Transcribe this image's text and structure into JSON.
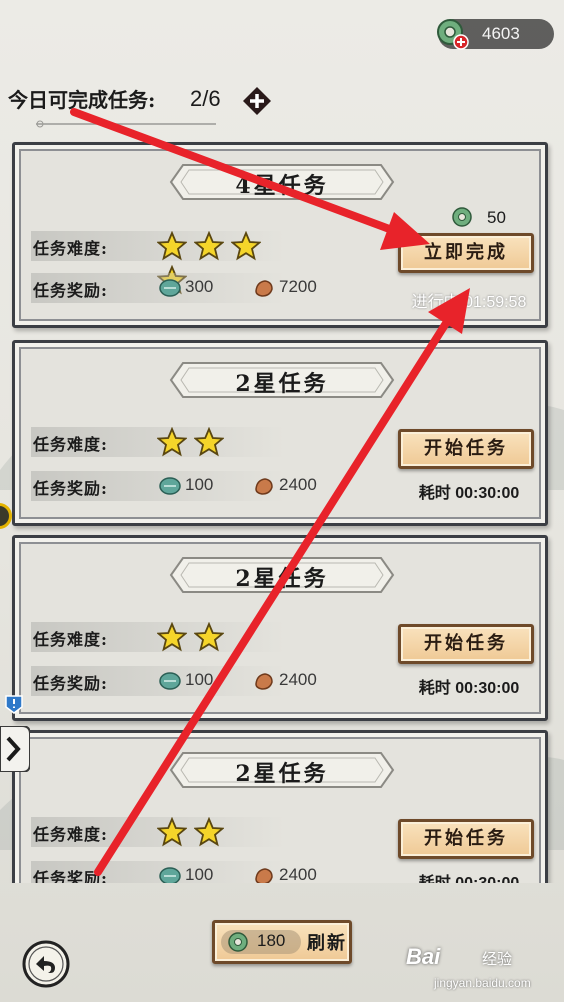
{
  "header": {
    "currency_amount": "4603",
    "daily_label": "今日可完成任务:",
    "daily_value": "2/6"
  },
  "tasks": [
    {
      "title": "4星任务",
      "difficulty_label": "任务难度:",
      "stars": 4,
      "reward_label": "任务奖励:",
      "reward_jade": "300",
      "reward_copper": "7200",
      "cost": "50",
      "button_label": "立即完成",
      "timer": "进行中 01:59:58"
    },
    {
      "title": "2星任务",
      "difficulty_label": "任务难度:",
      "stars": 2,
      "reward_label": "任务奖励:",
      "reward_jade": "100",
      "reward_copper": "2400",
      "button_label": "开始任务",
      "timer": "耗时 00:30:00"
    },
    {
      "title": "2星任务",
      "difficulty_label": "任务难度:",
      "stars": 2,
      "reward_label": "任务奖励:",
      "reward_jade": "100",
      "reward_copper": "2400",
      "button_label": "开始任务",
      "timer": "耗时 00:30:00"
    },
    {
      "title": "2星任务",
      "difficulty_label": "任务难度:",
      "stars": 2,
      "reward_label": "任务奖励:",
      "reward_jade": "100",
      "reward_copper": "2400",
      "button_label": "开始任务",
      "timer": "耗时 00:30:00"
    }
  ],
  "refresh": {
    "cost": "180",
    "label": "刷新"
  },
  "watermark": {
    "brand": "Bai",
    "brand2": "经验",
    "url": "jingyan.baidu.com"
  },
  "colors": {
    "arrow": "#e8232a",
    "button_fill": "#f6dcb2",
    "card_border": "#3b3e44",
    "star": "#f5d52a"
  },
  "icons": [
    "jade-coin-icon",
    "plus-icon",
    "star-icon",
    "jade-reward-icon",
    "copper-reward-icon",
    "back-icon",
    "chevron-right-icon"
  ]
}
